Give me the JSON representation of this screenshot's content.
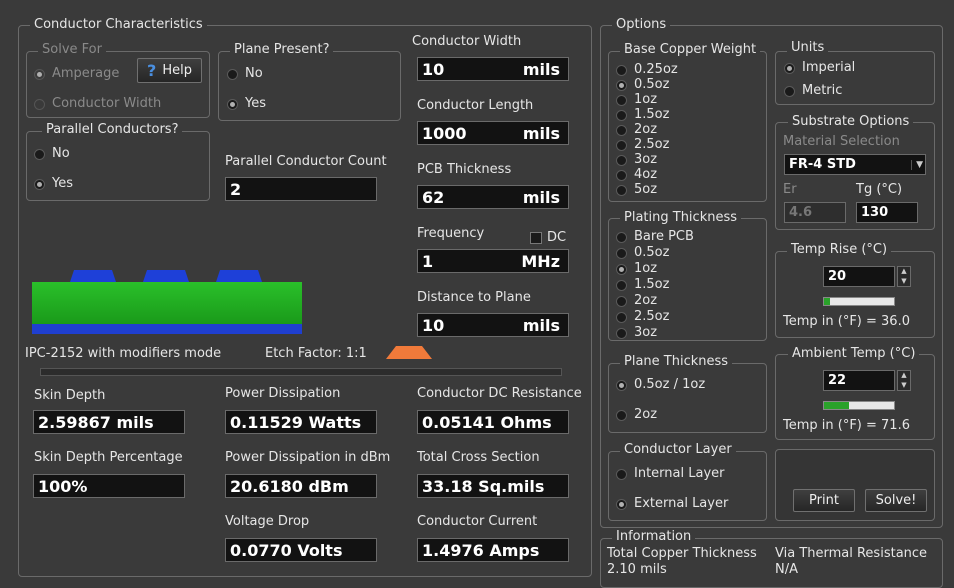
{
  "conductor": {
    "title": "Conductor Characteristics",
    "solve_for": {
      "title": "Solve For",
      "options": [
        "Amperage",
        "Conductor Width"
      ]
    },
    "help_label": "Help",
    "plane_present": {
      "title": "Plane Present?",
      "options": [
        "No",
        "Yes"
      ],
      "selected": "Yes"
    },
    "parallel": {
      "title": "Parallel Conductors?",
      "options": [
        "No",
        "Yes"
      ],
      "selected": "Yes"
    },
    "parallel_count_label": "Parallel Conductor Count",
    "parallel_count_value": "2",
    "width": {
      "label": "Conductor Width",
      "value": "10",
      "unit": "mils"
    },
    "length": {
      "label": "Conductor Length",
      "value": "1000",
      "unit": "mils"
    },
    "thickness": {
      "label": "PCB Thickness",
      "value": "62",
      "unit": "mils"
    },
    "frequency": {
      "label": "Frequency",
      "value": "1",
      "unit": "MHz",
      "dc_label": "DC"
    },
    "plane_distance": {
      "label": "Distance to Plane",
      "value": "10",
      "unit": "mils"
    },
    "mode_text": "IPC-2152 with modifiers mode",
    "etch_factor": "Etch Factor: 1:1"
  },
  "results": {
    "skin_depth": {
      "label": "Skin Depth",
      "value": "2.59867 mils"
    },
    "skin_depth_pct": {
      "label": "Skin Depth Percentage",
      "value": "100%"
    },
    "power_diss": {
      "label": "Power Dissipation",
      "value": "0.11529 Watts"
    },
    "power_dbm": {
      "label": "Power Dissipation in dBm",
      "value": "20.6180 dBm"
    },
    "voltage_drop": {
      "label": "Voltage Drop",
      "value": "0.0770 Volts"
    },
    "dc_resistance": {
      "label": "Conductor DC Resistance",
      "value": "0.05141 Ohms"
    },
    "cross_section": {
      "label": "Total Cross Section",
      "value": "33.18 Sq.mils"
    },
    "current": {
      "label": "Conductor Current",
      "value": "1.4976 Amps"
    }
  },
  "options": {
    "title": "Options",
    "base_copper": {
      "title": "Base Copper Weight",
      "options": [
        "0.25oz",
        "0.5oz",
        "1oz",
        "1.5oz",
        "2oz",
        "2.5oz",
        "3oz",
        "4oz",
        "5oz"
      ],
      "selected": "0.5oz"
    },
    "units": {
      "title": "Units",
      "options": [
        "Imperial",
        "Metric"
      ],
      "selected": "Imperial"
    },
    "substrate": {
      "title": "Substrate Options",
      "material_label": "Material Selection",
      "material_value": "FR-4 STD",
      "er_label": "Er",
      "er_value": "4.6",
      "tg_label": "Tg (°C)",
      "tg_value": "130"
    },
    "plating": {
      "title": "Plating Thickness",
      "options": [
        "Bare PCB",
        "0.5oz",
        "1oz",
        "1.5oz",
        "2oz",
        "2.5oz",
        "3oz"
      ],
      "selected": "1oz"
    },
    "temp_rise": {
      "title": "Temp Rise (°C)",
      "value": "20",
      "level": 0.09,
      "result": "Temp in (°F) = 36.0"
    },
    "plane_thickness": {
      "title": "Plane Thickness",
      "options": [
        "0.5oz / 1oz",
        "2oz"
      ],
      "selected": "0.5oz / 1oz"
    },
    "ambient": {
      "title": "Ambient Temp (°C)",
      "value": "22",
      "level": 0.35,
      "result": "Temp in (°F) = 71.6"
    },
    "layer": {
      "title": "Conductor Layer",
      "options": [
        "Internal Layer",
        "External Layer"
      ],
      "selected": "External Layer"
    },
    "print_label": "Print",
    "solve_label": "Solve!"
  },
  "info": {
    "title": "Information",
    "copper_label": "Total Copper Thickness",
    "copper_value": "2.10 mils",
    "via_label": "Via Thermal Resistance",
    "via_value": "N/A"
  },
  "colors": {
    "board_green": "#22b022",
    "board_blue": "#1f3fd0",
    "trace_blue": "#1e40d8",
    "etch_orange": "#f07a3a",
    "bar_green": "#2aa22a"
  }
}
